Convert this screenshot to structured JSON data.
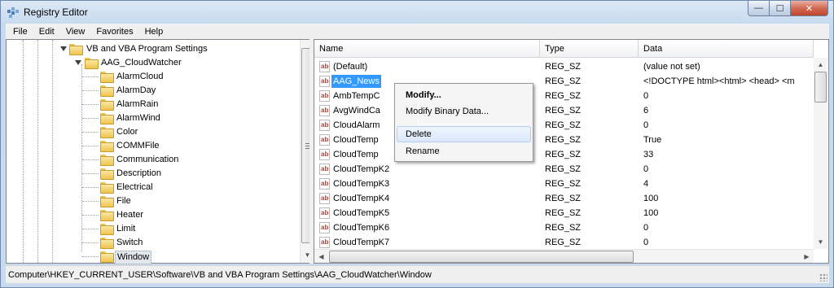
{
  "window": {
    "title": "Registry Editor",
    "controls": {
      "minimize": "—",
      "maximize": "☐",
      "close": "✕"
    }
  },
  "menu": [
    "File",
    "Edit",
    "View",
    "Favorites",
    "Help"
  ],
  "tree": {
    "parent": "VB and VBA Program Settings",
    "key": "AAG_CloudWatcher",
    "children": [
      "AlarmCloud",
      "AlarmDay",
      "AlarmRain",
      "AlarmWind",
      "Color",
      "COMMFile",
      "Communication",
      "Description",
      "Electrical",
      "File",
      "Heater",
      "Limit",
      "Switch",
      "Window"
    ],
    "selected": "Window"
  },
  "list": {
    "columns": [
      "Name",
      "Type",
      "Data"
    ],
    "rows": [
      {
        "name": "(Default)",
        "type": "REG_SZ",
        "data": "(value not set)"
      },
      {
        "name": "AAG_News",
        "type": "REG_SZ",
        "data": "<!DOCTYPE html><html>    <head>    <m"
      },
      {
        "name": "AmbTempC",
        "type": "REG_SZ",
        "data": "0"
      },
      {
        "name": "AvgWindCa",
        "type": "REG_SZ",
        "data": "6"
      },
      {
        "name": "CloudAlarm",
        "type": "REG_SZ",
        "data": "0"
      },
      {
        "name": "CloudTemp",
        "type": "REG_SZ",
        "data": "True"
      },
      {
        "name": "CloudTemp",
        "type": "REG_SZ",
        "data": "33"
      },
      {
        "name": "CloudTempK2",
        "type": "REG_SZ",
        "data": "0"
      },
      {
        "name": "CloudTempK3",
        "type": "REG_SZ",
        "data": "4"
      },
      {
        "name": "CloudTempK4",
        "type": "REG_SZ",
        "data": "100"
      },
      {
        "name": "CloudTempK5",
        "type": "REG_SZ",
        "data": "100"
      },
      {
        "name": "CloudTempK6",
        "type": "REG_SZ",
        "data": "0"
      },
      {
        "name": "CloudTempK7",
        "type": "REG_SZ",
        "data": "0"
      }
    ],
    "selected_index": 1,
    "value_icon": "ab"
  },
  "context_menu": {
    "items": [
      "Modify...",
      "Modify Binary Data...",
      "Delete",
      "Rename"
    ],
    "hovered": "Delete"
  },
  "status": "Computer\\HKEY_CURRENT_USER\\Software\\VB and VBA Program Settings\\AAG_CloudWatcher\\Window",
  "colors": {
    "selection": "#3399ff",
    "folder": "#eec550",
    "value_icon_text": "#c0392b"
  }
}
